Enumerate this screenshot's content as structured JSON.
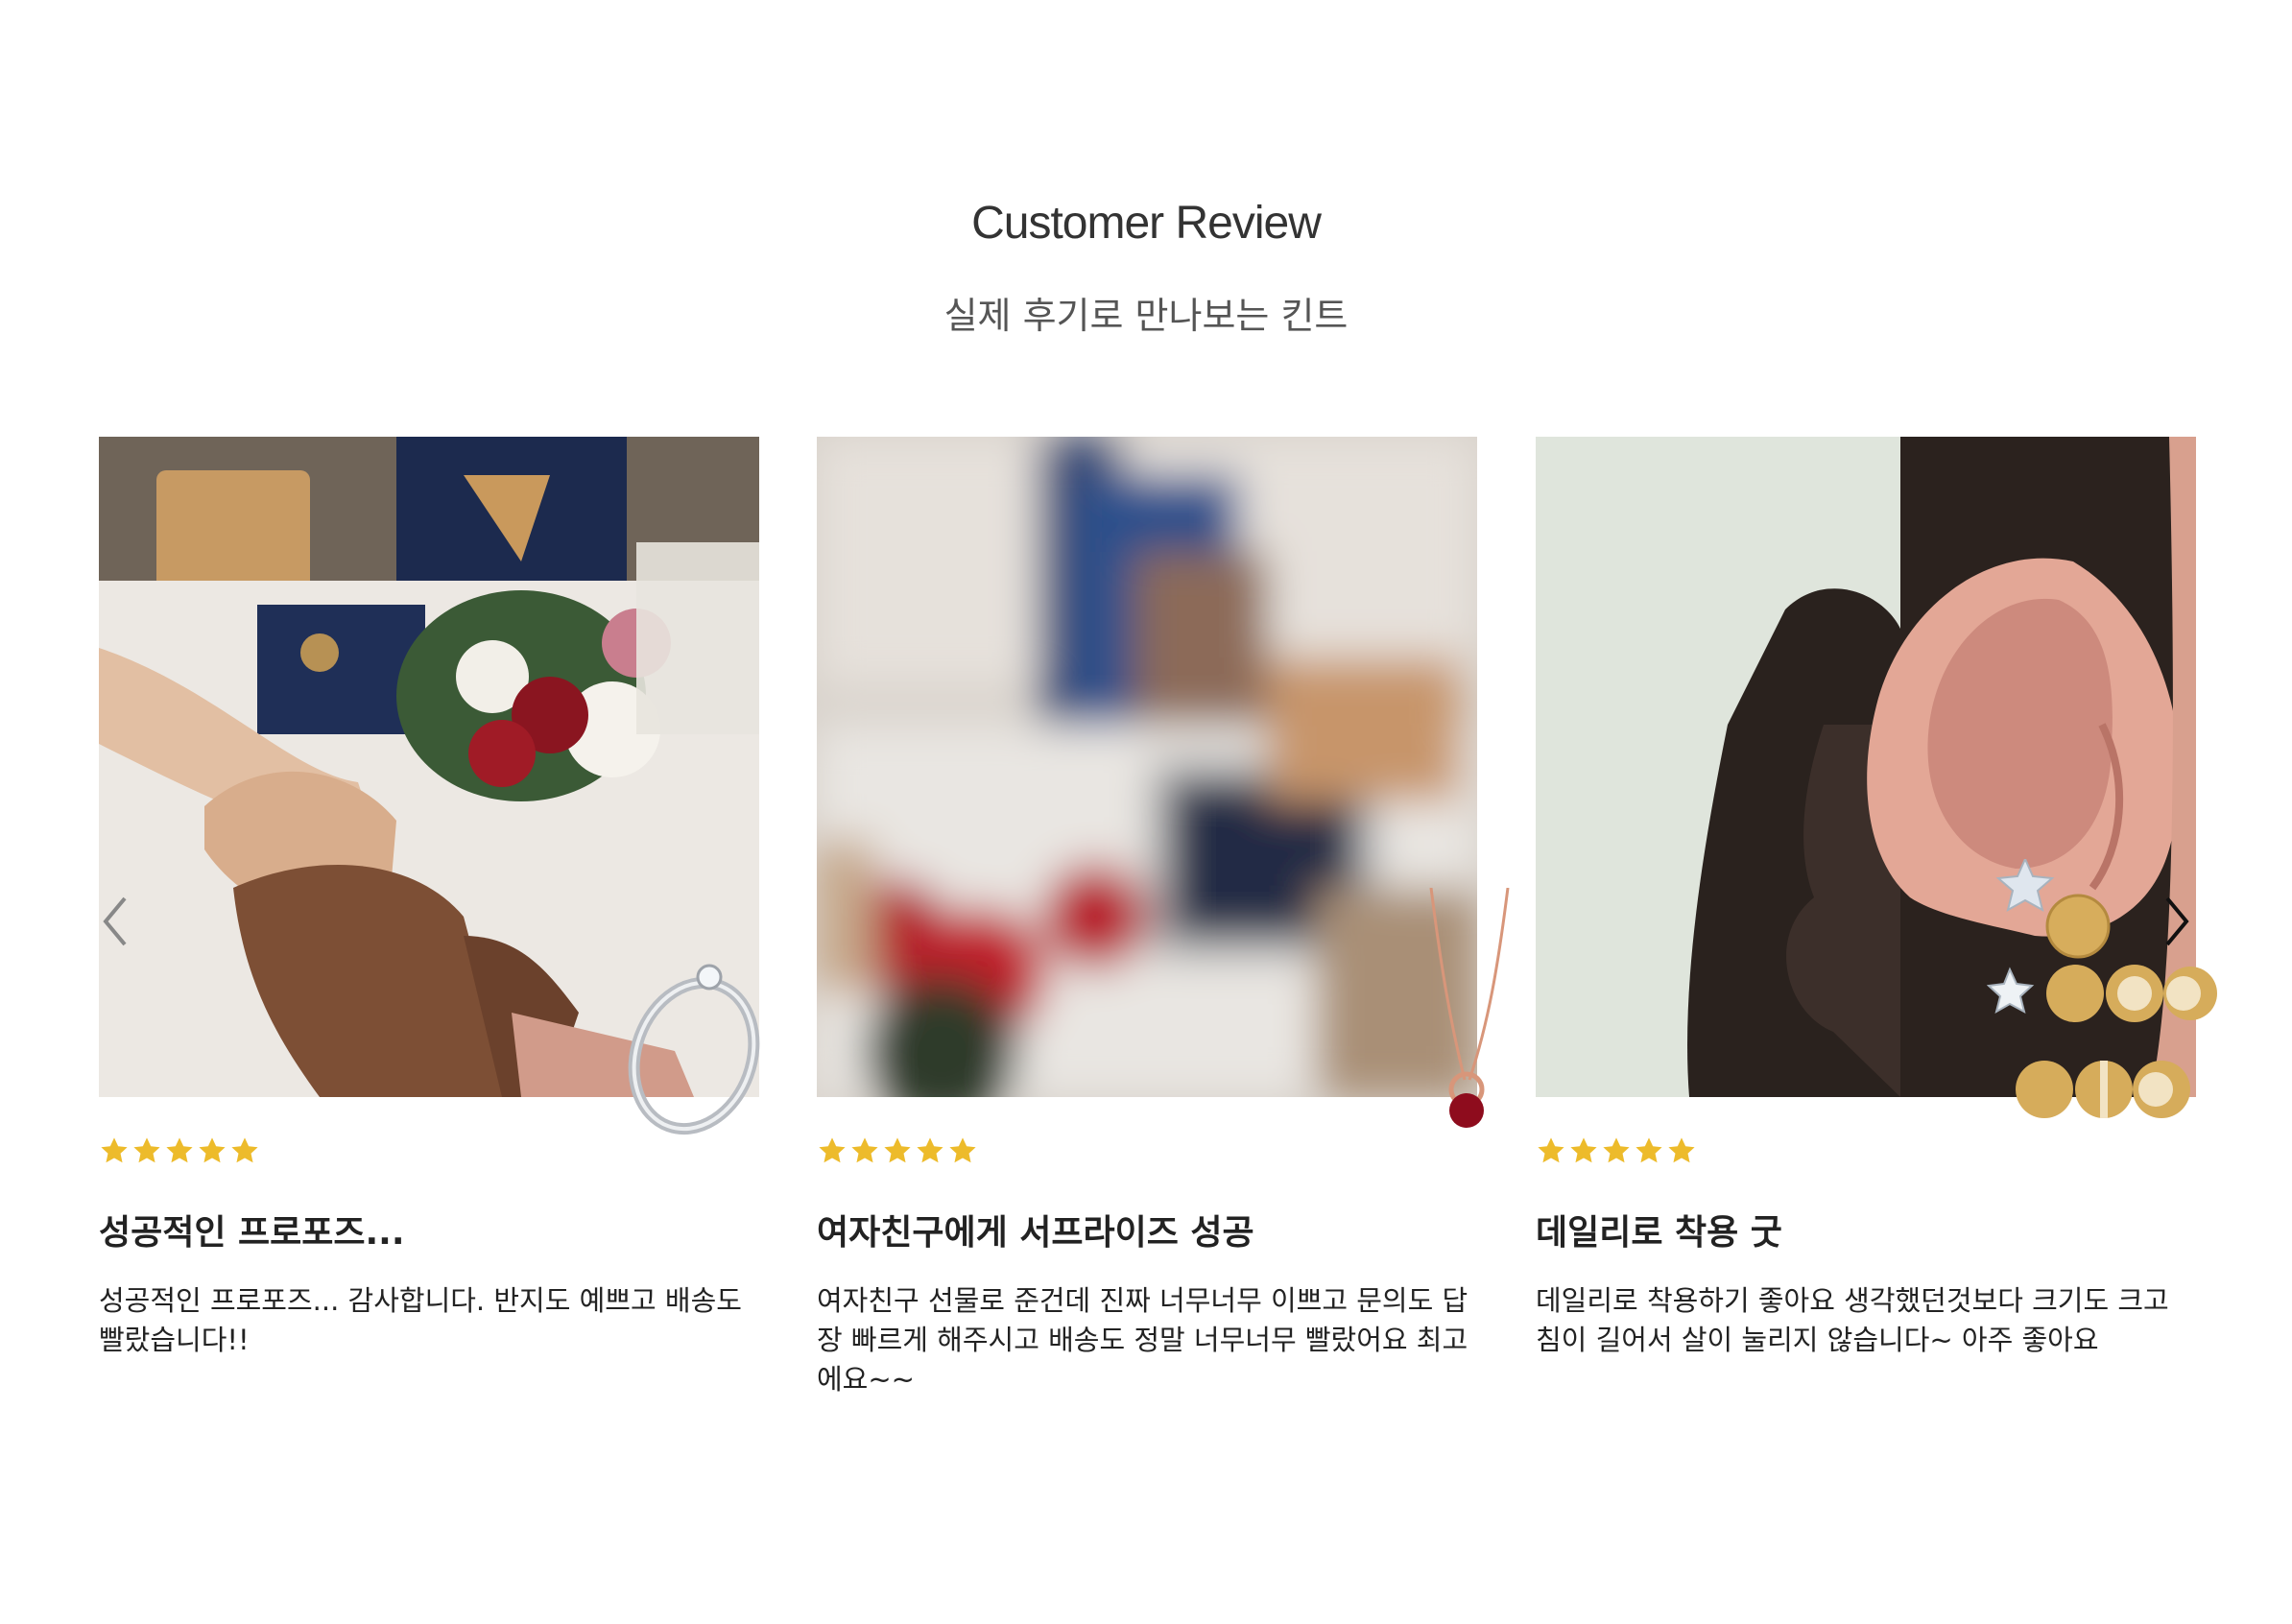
{
  "section": {
    "title": "Customer Review",
    "subtitle": "실제 후기로 만나보는 킨트"
  },
  "colors": {
    "star": "#EDBB2B",
    "text": "#222222",
    "subtitle": "#555555"
  },
  "reviews": [
    {
      "rating": 5,
      "title": "성공적인 프로포즈...",
      "body": "성공적인 프로포즈... 감사합니다. 반지도 예쁘고 배송도 빨랐습니다!!",
      "image": "proposal-ring-hands-flowers-photo",
      "product": "silver-solitaire-ring"
    },
    {
      "rating": 5,
      "title": "여자친구에게 서프라이즈 성공",
      "body": "여자친구 선물로 준건데 진짜 너무너무 이쁘고 문의도 답장 빠르게 해주시고 배송도 정말 너무너무 빨랐어요 최고에요~~",
      "image": "blurred-gift-box-photo",
      "product": "rose-gold-garnet-necklace"
    },
    {
      "rating": 5,
      "title": "데일리로 착용 굿",
      "body": "데일리로 착용하기 좋아요 생각했던것보다 크기도 크고 침이 길어서 살이 눌리지 않습니다~ 아주 좋아요",
      "image": "ear-earrings-photo",
      "product": "gold-moon-star-earring-set"
    }
  ],
  "icons": {
    "prev": "chevron-left-icon",
    "next": "chevron-right-icon",
    "star": "star-icon"
  }
}
